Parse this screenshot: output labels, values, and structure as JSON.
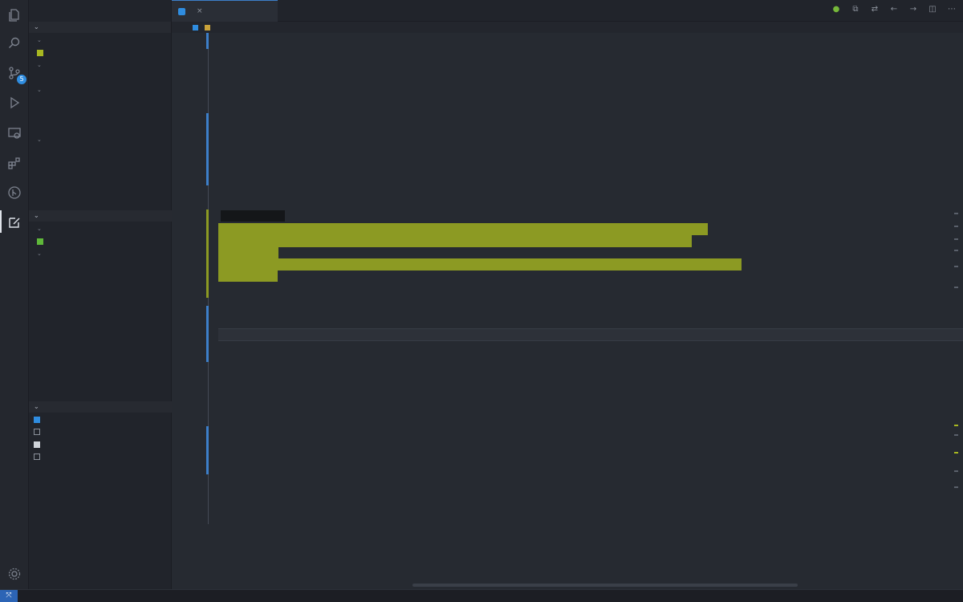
{
  "activity_bar": {
    "icons": [
      "files-icon",
      "search-icon",
      "source-control-icon",
      "run-debug-icon",
      "remote-explorer-icon",
      "extensions-icon",
      "git-graph-icon",
      "notes-icon"
    ],
    "scm_badge": "5"
  },
  "sidebar": {
    "title": "",
    "section1": {
      "label": ""
    },
    "section2": {
      "label": ""
    },
    "section3": {
      "label": ""
    }
  },
  "tab": {
    "label": ""
  },
  "breadcrumb": {
    "parts": [
      "",
      "",
      "",
      "",
      ""
    ]
  },
  "editor": {
    "tooltip": "",
    "ghost_text": "",
    "lines": [
      {
        "n": "",
        "t": ""
      }
    ]
  },
  "statusbar": {
    "left1": "",
    "left2": "",
    "right": [
      "",
      "",
      "",
      "",
      "",
      "",
      ""
    ]
  },
  "colors": {
    "accent": "#2f8de0",
    "highlight": "#8c9a23",
    "status_remote": "#2c64b5"
  }
}
